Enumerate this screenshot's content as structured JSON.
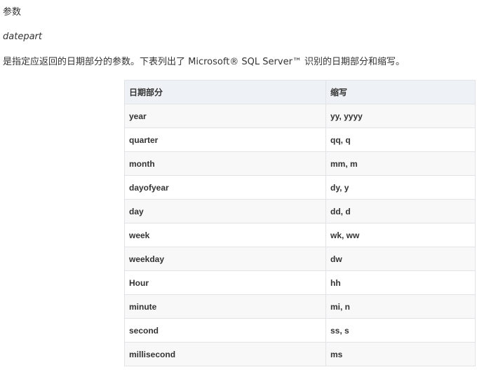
{
  "section": {
    "heading": "参数",
    "param_name": "datepart",
    "description": "是指定应返回的日期部分的参数。下表列出了 Microsoft® SQL Server™ 识别的日期部分和缩写。"
  },
  "table": {
    "headers": [
      "日期部分",
      "缩写"
    ],
    "rows": [
      [
        "year",
        "yy, yyyy"
      ],
      [
        "quarter",
        "qq, q"
      ],
      [
        "month",
        "mm, m"
      ],
      [
        "dayofyear",
        "dy, y"
      ],
      [
        "day",
        "dd, d"
      ],
      [
        "week",
        "wk, ww"
      ],
      [
        "weekday",
        "dw"
      ],
      [
        "Hour",
        "hh"
      ],
      [
        "minute",
        "mi, n"
      ],
      [
        "second",
        "ss, s"
      ],
      [
        "millisecond",
        "ms"
      ]
    ]
  }
}
